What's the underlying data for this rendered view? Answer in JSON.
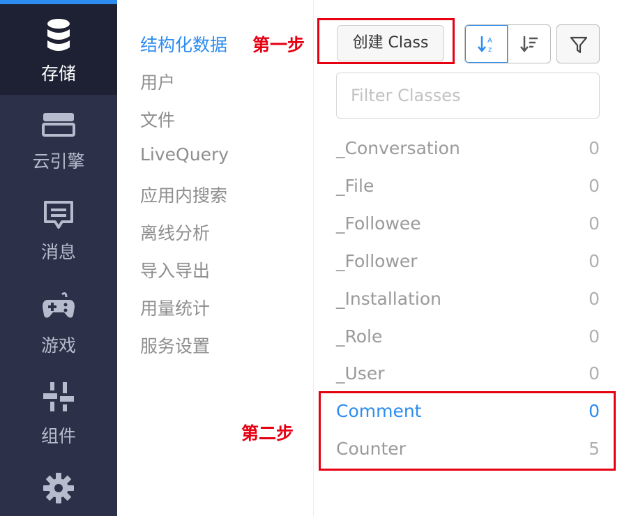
{
  "sidebar": {
    "items": [
      {
        "label": "存储",
        "icon": "database-icon",
        "active": true
      },
      {
        "label": "云引擎",
        "icon": "server-icon"
      },
      {
        "label": "消息",
        "icon": "message-icon"
      },
      {
        "label": "游戏",
        "icon": "gamepad-icon"
      },
      {
        "label": "组件",
        "icon": "components-icon"
      },
      {
        "label": "",
        "icon": "gear-icon"
      }
    ]
  },
  "menu": {
    "items": [
      "结构化数据",
      "用户",
      "文件",
      "LiveQuery",
      "应用内搜索",
      "离线分析",
      "导入导出",
      "用量统计",
      "服务设置"
    ],
    "active_index": 0
  },
  "toolbar": {
    "create_label": "创建 Class",
    "sort_alpha_icon": "sort-alpha-icon",
    "sort_count_icon": "sort-count-icon",
    "filter_icon": "filter-icon"
  },
  "search": {
    "placeholder": "Filter Classes",
    "value": ""
  },
  "classes": [
    {
      "name": "_Conversation",
      "count": "0"
    },
    {
      "name": "_File",
      "count": "0"
    },
    {
      "name": "_Followee",
      "count": "0"
    },
    {
      "name": "_Follower",
      "count": "0"
    },
    {
      "name": "_Installation",
      "count": "0"
    },
    {
      "name": "_Role",
      "count": "0"
    },
    {
      "name": "_User",
      "count": "0"
    },
    {
      "name": "Comment",
      "count": "0",
      "active": true
    },
    {
      "name": "Counter",
      "count": "5"
    }
  ],
  "annotations": {
    "step1": "第一步",
    "step2": "第二步"
  },
  "colors": {
    "accent": "#2d8cf0",
    "sidebar": "#2c3048",
    "annotation": "#e60012"
  }
}
